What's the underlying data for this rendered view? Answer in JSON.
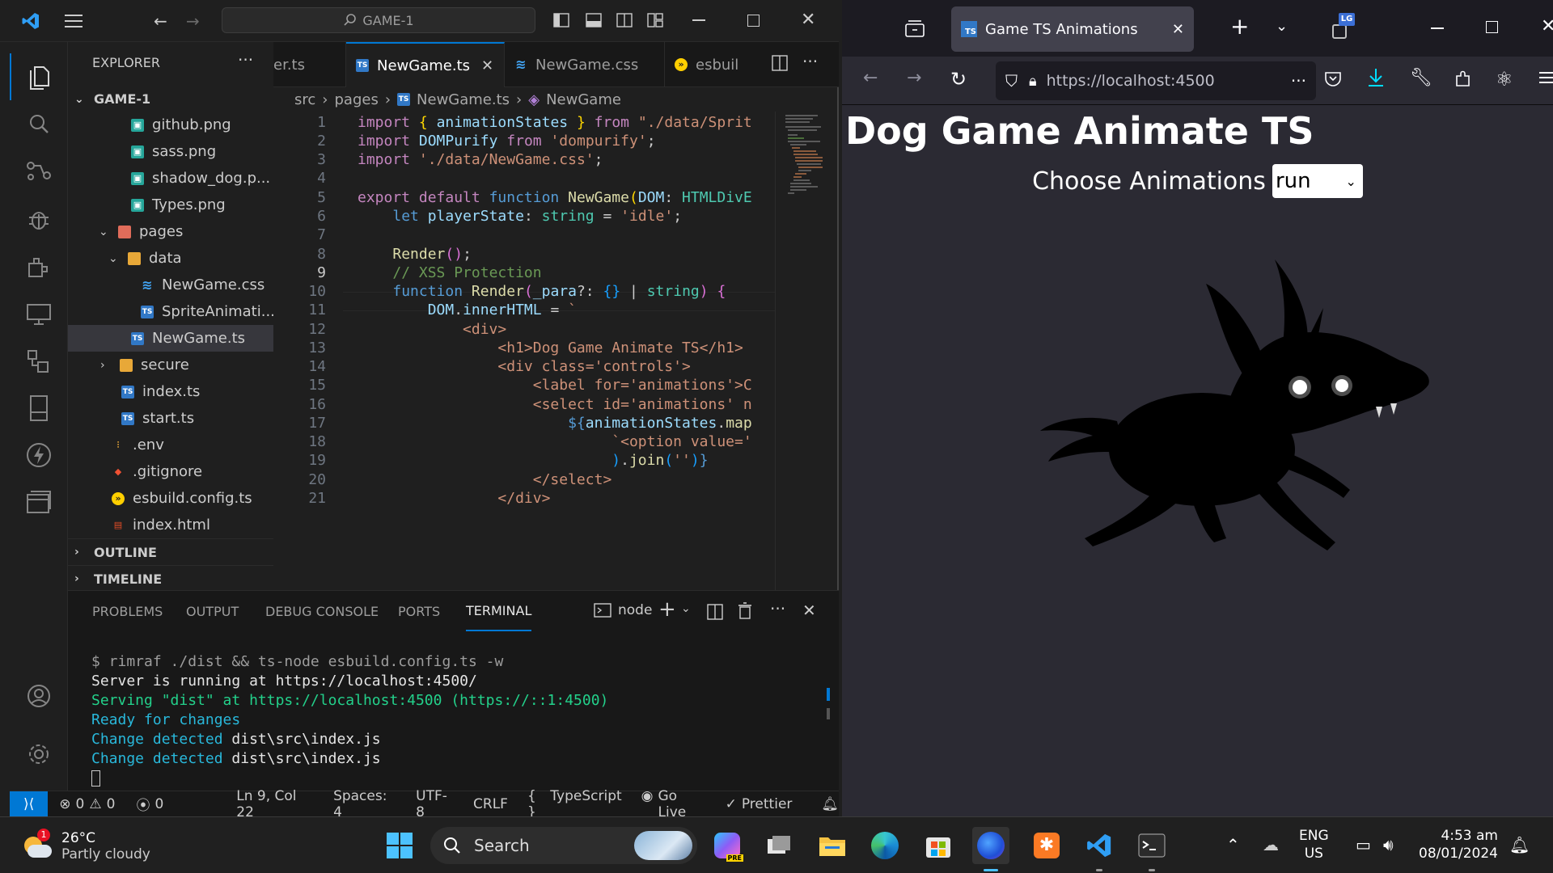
{
  "vscode": {
    "search_label": "GAME-1",
    "explorer": {
      "title": "EXPLORER",
      "root": "GAME-1",
      "items": [
        {
          "label": "github.png"
        },
        {
          "label": "sass.png"
        },
        {
          "label": "shadow_dog.p..."
        },
        {
          "label": "Types.png"
        },
        {
          "label": "pages"
        },
        {
          "label": "data"
        },
        {
          "label": "NewGame.css"
        },
        {
          "label": "SpriteAnimati..."
        },
        {
          "label": "NewGame.ts"
        },
        {
          "label": "secure"
        },
        {
          "label": "index.ts"
        },
        {
          "label": "start.ts"
        },
        {
          "label": ".env"
        },
        {
          "label": ".gitignore"
        },
        {
          "label": "esbuild.config.ts"
        },
        {
          "label": "index.html"
        }
      ],
      "outline": "OUTLINE",
      "timeline": "TIMELINE"
    },
    "tabs": [
      {
        "label": "er.ts"
      },
      {
        "label": "NewGame.ts"
      },
      {
        "label": "NewGame.css"
      },
      {
        "label": "esbuil"
      }
    ],
    "breadcrumb": {
      "part1": "src",
      "part2": "pages",
      "part3": "NewGame.ts",
      "part4": "NewGame"
    },
    "line_numbers": [
      "1",
      "2",
      "3",
      "4",
      "5",
      "6",
      "7",
      "8",
      "9",
      "10",
      "11",
      "12",
      "13",
      "14",
      "15",
      "16",
      "17",
      "18",
      "19",
      "20",
      "21"
    ],
    "code": {
      "l1a": "import",
      "l1b": "{",
      "l1c": "animationStates",
      "l1d": "}",
      "l1e": "from",
      "l1f": "\"./data/Sprit",
      "l2a": "import",
      "l2b": "DOMPurify",
      "l2c": "from",
      "l2d": "'dompurify'",
      "l2e": ";",
      "l3a": "import",
      "l3b": "'./data/NewGame.css'",
      "l3c": ";",
      "l5a": "export",
      "l5b": "default",
      "l5c": "function",
      "l5d": "NewGame",
      "l5e": "(",
      "l5f": "DOM",
      "l5g": ":",
      "l5h": "HTMLDivE",
      "l6a": "let",
      "l6b": "playerState",
      "l6c": ":",
      "l6d": "string",
      "l6e": "=",
      "l6f": "'idle'",
      "l6g": ";",
      "l8a": "Render",
      "l8b": "()",
      "l8c": ";",
      "l9": "// XSS Protection",
      "l10a": "function",
      "l10b": "Render",
      "l10c": "(",
      "l10d": "_para",
      "l10e": "?:",
      "l10f": "{}",
      "l10g": "|",
      "l10h": "string",
      "l10i": ")",
      "l10j": "{",
      "l11a": "DOM",
      "l11b": ".",
      "l11c": "innerHTML",
      "l11d": "=",
      "l11e": "`",
      "l12": "<div>",
      "l13": "<h1>Dog Game Animate TS</h1>",
      "l14": "<div class='controls'>",
      "l15": "<label for='animations'>C",
      "l16": "<select id='animations' n",
      "l17a": "${",
      "l17b": "animationStates",
      "l17c": ".",
      "l17d": "map",
      "l18": "`<option value='",
      "l19a": ")",
      "l19b": ".",
      "l19c": "join",
      "l19d": "(",
      "l19e": "''",
      "l19f": ")",
      "l19g": "}",
      "l20": "</select>",
      "l21": "</div>"
    },
    "panel": {
      "tabs": [
        "PROBLEMS",
        "OUTPUT",
        "DEBUG CONSOLE",
        "PORTS",
        "TERMINAL"
      ],
      "shell": "node",
      "lines": {
        "t1": "$ rimraf ./dist && ts-node esbuild.config.ts -w",
        "t2": "Server is running at https://localhost:4500/",
        "t3": "Serving \"dist\" at https://localhost:4500 (https://::1:4500)",
        "t4": "Ready for changes",
        "t5a": "Change detected",
        "t5b": " dist\\src\\index.js",
        "t6a": "Change detected",
        "t6b": " dist\\src\\index.js"
      }
    },
    "status": {
      "errors": "0",
      "warnings": "0",
      "ports": "0",
      "position": "Ln 9, Col 22",
      "spaces": "Spaces: 4",
      "encoding": "UTF-8",
      "eol": "CRLF",
      "language": "TypeScript",
      "golive": "Go Live",
      "prettier": "Prettier"
    }
  },
  "firefox": {
    "tab_title": "Game TS Animations",
    "tab_icon": "TS",
    "profile_badge": "LG",
    "url": "https://localhost:4500",
    "page": {
      "heading": "Dog Game Animate TS",
      "label": "Choose Animations",
      "select_value": "run"
    }
  },
  "taskbar": {
    "weather_temp": "26°C",
    "weather_desc": "Partly cloudy",
    "weather_badge": "1",
    "search": "Search",
    "lang1": "ENG",
    "lang2": "US",
    "time": "4:53 am",
    "date": "08/01/2024"
  },
  "colors": {
    "accent": "#0078d4",
    "editor_bg": "#1f1f1f",
    "browser_bg": "#2b2a33",
    "taskbar_bg": "#202020"
  }
}
